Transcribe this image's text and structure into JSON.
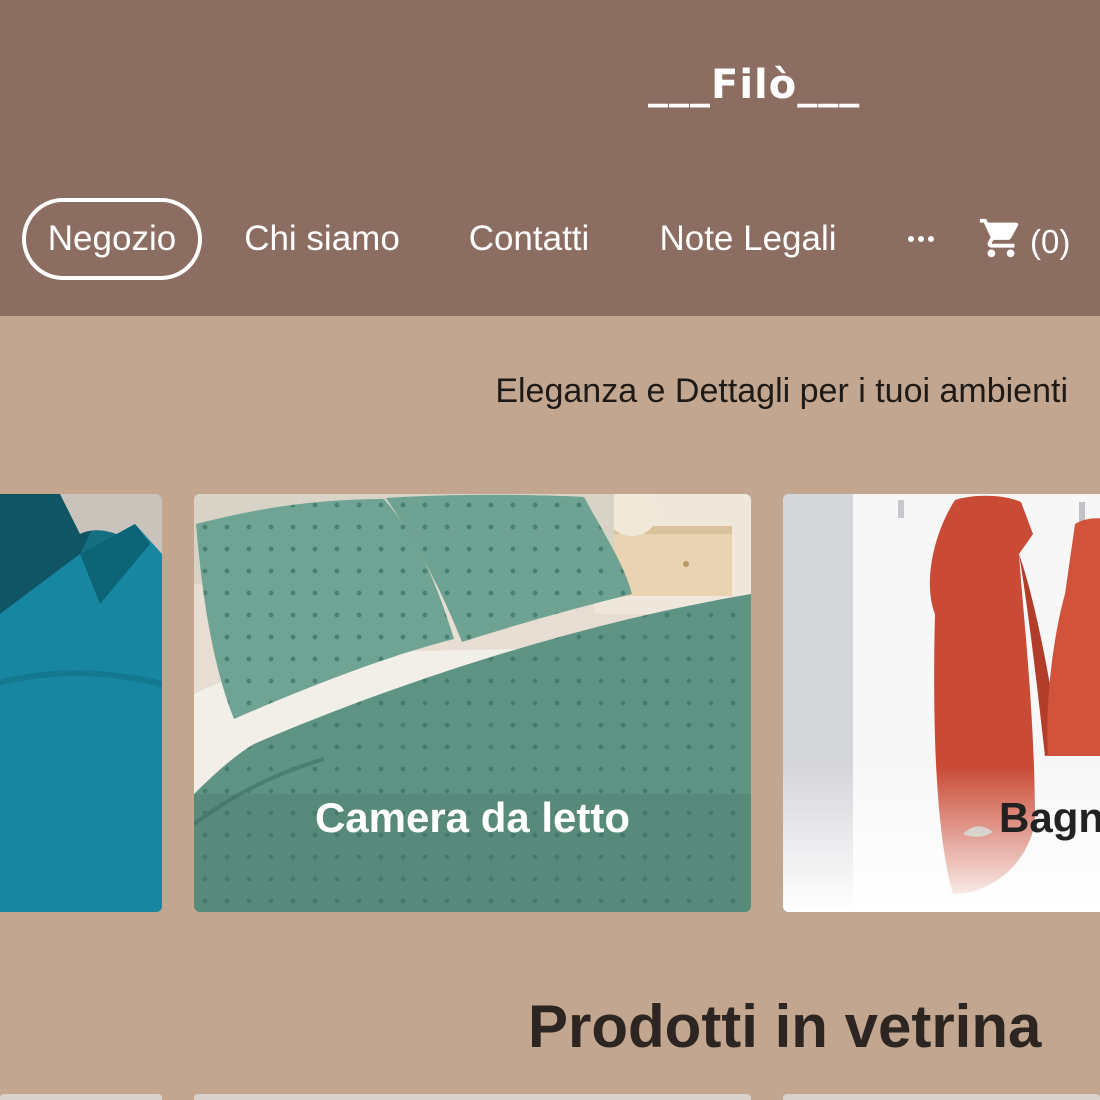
{
  "brand": {
    "logo": "___Filò___"
  },
  "nav": {
    "items": [
      {
        "label": "Negozio",
        "active": true
      },
      {
        "label": "Chi siamo",
        "active": false
      },
      {
        "label": "Contatti",
        "active": false
      },
      {
        "label": "Note Legali",
        "active": false
      }
    ],
    "more_icon": "more-horizontal-icon",
    "cart": {
      "icon": "shopping-cart-icon",
      "count_label": "(0)"
    }
  },
  "hero": {
    "tagline": "Eleganza e Dettagli per i tuoi ambienti"
  },
  "categories": [
    {
      "label": ""
    },
    {
      "label": "Camera da letto"
    },
    {
      "label": "Bagno"
    }
  ],
  "featured": {
    "title": "Prodotti in vetrina"
  },
  "colors": {
    "header_bg": "#8c6d61",
    "page_bg": "#c3a68f",
    "text_dark": "#2c2522",
    "white": "#ffffff"
  }
}
